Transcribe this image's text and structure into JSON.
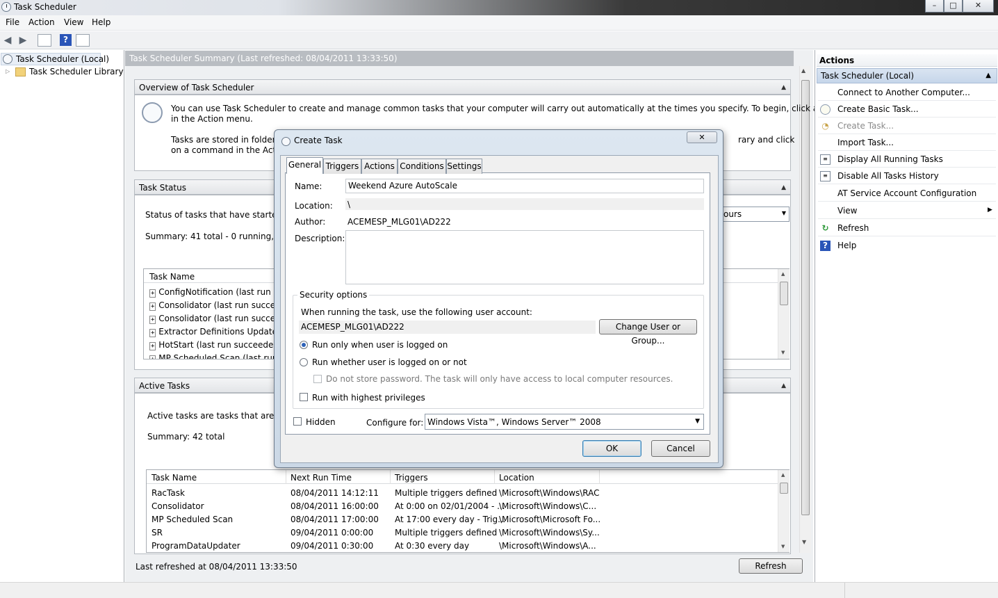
{
  "window": {
    "title": "Task Scheduler",
    "controls": {
      "minimize": "–",
      "maximize": "□",
      "close": "✕"
    }
  },
  "menu": [
    "File",
    "Action",
    "View",
    "Help"
  ],
  "tree": {
    "root": "Task Scheduler (Local)",
    "child": "Task Scheduler Library"
  },
  "center": {
    "header": "Task Scheduler Summary (Last refreshed: 08/04/2011 13:33:50)",
    "overview": {
      "title": "Overview of Task Scheduler",
      "p1": "You can use Task Scheduler to create and manage common tasks that your computer will carry out automatically at the times you specify. To begin, click a command",
      "p1b": "in the Action menu.",
      "p2a": "Tasks are stored in folders in",
      "p2b": "rary and click",
      "p2c": "on a command in the Action"
    },
    "task_status": {
      "title": "Task Status",
      "status_line": "Status of tasks that have started in t",
      "combo_tail": "ours",
      "summary": "Summary: 41 total - 0 running, 41 s",
      "column": "Task Name",
      "rows": [
        "ConfigNotification (last run suc",
        "Consolidator (last run succeede",
        "Consolidator (last run succeede",
        "Extractor Definitions Update Ta",
        "HotStart (last run succeeded at",
        "MP Scheduled Scan (last run su"
      ]
    },
    "active_tasks": {
      "title": "Active Tasks",
      "desc": "Active tasks are tasks that are curre",
      "summary": "Summary: 42 total",
      "columns": [
        "Task Name",
        "Next Run Time",
        "Triggers",
        "Location"
      ],
      "rows": [
        [
          "RacTask",
          "08/04/2011 14:12:11",
          "Multiple triggers defined",
          "\\Microsoft\\Windows\\RAC"
        ],
        [
          "Consolidator",
          "08/04/2011 16:00:00",
          "At 0:00 on 02/01/2004 - ...",
          "\\Microsoft\\Windows\\C..."
        ],
        [
          "MP Scheduled Scan",
          "08/04/2011 17:00:00",
          "At 17:00 every day - Trig...",
          "\\Microsoft\\Microsoft Fo..."
        ],
        [
          "SR",
          "09/04/2011 0:00:00",
          "Multiple triggers defined",
          "\\Microsoft\\Windows\\Sy..."
        ],
        [
          "ProgramDataUpdater",
          "09/04/2011 0:30:00",
          "At 0:30 every day",
          "\\Microsoft\\Windows\\A..."
        ]
      ]
    },
    "footer": {
      "last_refreshed": "Last refreshed at 08/04/2011 13:33:50",
      "refresh_button": "Refresh"
    }
  },
  "actions": {
    "title": "Actions",
    "group": "Task Scheduler (Local)",
    "items": [
      {
        "label": "Connect to Another Computer...",
        "icon": "none"
      },
      {
        "label": "Create Basic Task...",
        "icon": "clock-wizard-icon"
      },
      {
        "label": "Create Task...",
        "icon": "clock-icon"
      },
      {
        "label": "Import Task...",
        "icon": "none"
      },
      {
        "label": "Display All Running Tasks",
        "icon": "list-icon"
      },
      {
        "label": "Disable All Tasks History",
        "icon": "history-icon"
      },
      {
        "label": "AT Service Account Configuration",
        "icon": "none"
      },
      {
        "label": "View",
        "icon": "none"
      },
      {
        "label": "Refresh",
        "icon": "refresh-icon"
      },
      {
        "label": "Help",
        "icon": "help-icon"
      }
    ]
  },
  "dialog": {
    "title": "Create Task",
    "tabs": [
      "General",
      "Triggers",
      "Actions",
      "Conditions",
      "Settings"
    ],
    "name_label": "Name:",
    "name_value": "Weekend Azure AutoScale",
    "location_label": "Location:",
    "location_value": "\\",
    "author_label": "Author:",
    "author_value": "ACEMESP_MLG01\\AD222",
    "description_label": "Description:",
    "security_title": "Security options",
    "account_prompt": "When running the task, use the following user account:",
    "account_value": "ACEMESP_MLG01\\AD222",
    "change_user_button": "Change User or Group...",
    "radio_logged_on": "Run only when user is logged on",
    "radio_whether": "Run whether user is logged on or not",
    "no_store_password": "Do not store password.  The task will only have access to local computer resources.",
    "highest_priv": "Run with highest privileges",
    "hidden": "Hidden",
    "configure_label": "Configure for:",
    "configure_value": "Windows Vista™, Windows Server™ 2008",
    "ok": "OK",
    "cancel": "Cancel"
  }
}
